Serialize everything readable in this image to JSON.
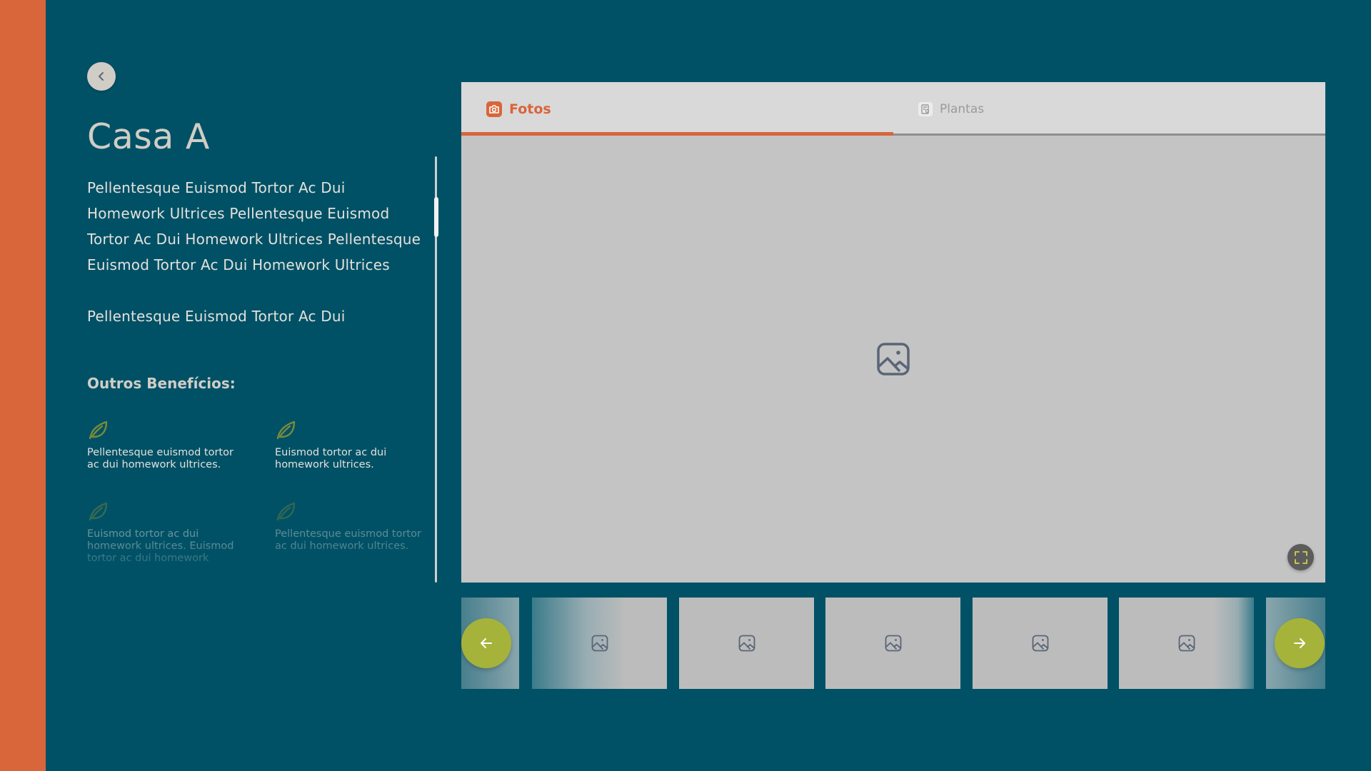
{
  "page": {
    "title": "Casa A",
    "back_icon": "chevron-left-icon"
  },
  "description": {
    "paragraph1": "Pellentesque Euismod Tortor Ac Dui Homework Ultrices Pellentesque Euismod Tortor Ac Dui Homework Ultrices Pellentesque Euismod Tortor Ac Dui Homework Ultrices",
    "paragraph2": "Pellentesque Euismod Tortor Ac Dui"
  },
  "benefits": {
    "title": "Outros Benefícios:",
    "icon": "leaf-icon",
    "items": [
      {
        "text": "Pellentesque euismod tortor ac dui homework ultrices."
      },
      {
        "text": "Euismod tortor ac dui homework ultrices."
      },
      {
        "text": "Euismod tortor ac dui homework ultrices. Euismod tortor ac dui homework"
      },
      {
        "text": "Pellentesque euismod tortor ac dui homework ultrices."
      }
    ]
  },
  "tabs": [
    {
      "label": "Fotos",
      "icon": "camera-icon",
      "active": true
    },
    {
      "label": "Plantas",
      "icon": "floorplan-icon",
      "active": false
    }
  ],
  "colors": {
    "background": "#005166",
    "accent": "#d9653b",
    "nav_button": "#a5b33a",
    "text_light": "#d0cdc6"
  },
  "gallery": {
    "main_image_icon": "image-placeholder-icon",
    "fullscreen_icon": "fullscreen-icon",
    "prev_icon": "arrow-left-icon",
    "next_icon": "arrow-right-icon",
    "thumbnail_icon": "image-placeholder-icon"
  }
}
